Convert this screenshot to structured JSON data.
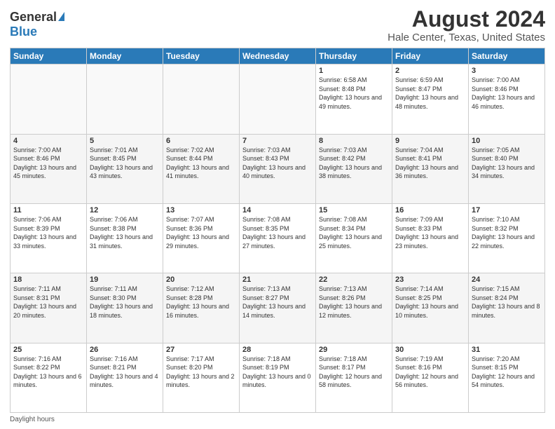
{
  "logo": {
    "general": "General",
    "blue": "Blue"
  },
  "title": "August 2024",
  "subtitle": "Hale Center, Texas, United States",
  "days": [
    "Sunday",
    "Monday",
    "Tuesday",
    "Wednesday",
    "Thursday",
    "Friday",
    "Saturday"
  ],
  "weeks": [
    [
      {
        "day": "",
        "text": ""
      },
      {
        "day": "",
        "text": ""
      },
      {
        "day": "",
        "text": ""
      },
      {
        "day": "",
        "text": ""
      },
      {
        "day": "1",
        "text": "Sunrise: 6:58 AM\nSunset: 8:48 PM\nDaylight: 13 hours and 49 minutes."
      },
      {
        "day": "2",
        "text": "Sunrise: 6:59 AM\nSunset: 8:47 PM\nDaylight: 13 hours and 48 minutes."
      },
      {
        "day": "3",
        "text": "Sunrise: 7:00 AM\nSunset: 8:46 PM\nDaylight: 13 hours and 46 minutes."
      }
    ],
    [
      {
        "day": "4",
        "text": "Sunrise: 7:00 AM\nSunset: 8:46 PM\nDaylight: 13 hours and 45 minutes."
      },
      {
        "day": "5",
        "text": "Sunrise: 7:01 AM\nSunset: 8:45 PM\nDaylight: 13 hours and 43 minutes."
      },
      {
        "day": "6",
        "text": "Sunrise: 7:02 AM\nSunset: 8:44 PM\nDaylight: 13 hours and 41 minutes."
      },
      {
        "day": "7",
        "text": "Sunrise: 7:03 AM\nSunset: 8:43 PM\nDaylight: 13 hours and 40 minutes."
      },
      {
        "day": "8",
        "text": "Sunrise: 7:03 AM\nSunset: 8:42 PM\nDaylight: 13 hours and 38 minutes."
      },
      {
        "day": "9",
        "text": "Sunrise: 7:04 AM\nSunset: 8:41 PM\nDaylight: 13 hours and 36 minutes."
      },
      {
        "day": "10",
        "text": "Sunrise: 7:05 AM\nSunset: 8:40 PM\nDaylight: 13 hours and 34 minutes."
      }
    ],
    [
      {
        "day": "11",
        "text": "Sunrise: 7:06 AM\nSunset: 8:39 PM\nDaylight: 13 hours and 33 minutes."
      },
      {
        "day": "12",
        "text": "Sunrise: 7:06 AM\nSunset: 8:38 PM\nDaylight: 13 hours and 31 minutes."
      },
      {
        "day": "13",
        "text": "Sunrise: 7:07 AM\nSunset: 8:36 PM\nDaylight: 13 hours and 29 minutes."
      },
      {
        "day": "14",
        "text": "Sunrise: 7:08 AM\nSunset: 8:35 PM\nDaylight: 13 hours and 27 minutes."
      },
      {
        "day": "15",
        "text": "Sunrise: 7:08 AM\nSunset: 8:34 PM\nDaylight: 13 hours and 25 minutes."
      },
      {
        "day": "16",
        "text": "Sunrise: 7:09 AM\nSunset: 8:33 PM\nDaylight: 13 hours and 23 minutes."
      },
      {
        "day": "17",
        "text": "Sunrise: 7:10 AM\nSunset: 8:32 PM\nDaylight: 13 hours and 22 minutes."
      }
    ],
    [
      {
        "day": "18",
        "text": "Sunrise: 7:11 AM\nSunset: 8:31 PM\nDaylight: 13 hours and 20 minutes."
      },
      {
        "day": "19",
        "text": "Sunrise: 7:11 AM\nSunset: 8:30 PM\nDaylight: 13 hours and 18 minutes."
      },
      {
        "day": "20",
        "text": "Sunrise: 7:12 AM\nSunset: 8:28 PM\nDaylight: 13 hours and 16 minutes."
      },
      {
        "day": "21",
        "text": "Sunrise: 7:13 AM\nSunset: 8:27 PM\nDaylight: 13 hours and 14 minutes."
      },
      {
        "day": "22",
        "text": "Sunrise: 7:13 AM\nSunset: 8:26 PM\nDaylight: 13 hours and 12 minutes."
      },
      {
        "day": "23",
        "text": "Sunrise: 7:14 AM\nSunset: 8:25 PM\nDaylight: 13 hours and 10 minutes."
      },
      {
        "day": "24",
        "text": "Sunrise: 7:15 AM\nSunset: 8:24 PM\nDaylight: 13 hours and 8 minutes."
      }
    ],
    [
      {
        "day": "25",
        "text": "Sunrise: 7:16 AM\nSunset: 8:22 PM\nDaylight: 13 hours and 6 minutes."
      },
      {
        "day": "26",
        "text": "Sunrise: 7:16 AM\nSunset: 8:21 PM\nDaylight: 13 hours and 4 minutes."
      },
      {
        "day": "27",
        "text": "Sunrise: 7:17 AM\nSunset: 8:20 PM\nDaylight: 13 hours and 2 minutes."
      },
      {
        "day": "28",
        "text": "Sunrise: 7:18 AM\nSunset: 8:19 PM\nDaylight: 13 hours and 0 minutes."
      },
      {
        "day": "29",
        "text": "Sunrise: 7:18 AM\nSunset: 8:17 PM\nDaylight: 12 hours and 58 minutes."
      },
      {
        "day": "30",
        "text": "Sunrise: 7:19 AM\nSunset: 8:16 PM\nDaylight: 12 hours and 56 minutes."
      },
      {
        "day": "31",
        "text": "Sunrise: 7:20 AM\nSunset: 8:15 PM\nDaylight: 12 hours and 54 minutes."
      }
    ]
  ],
  "footer": {
    "daylight_label": "Daylight hours"
  }
}
